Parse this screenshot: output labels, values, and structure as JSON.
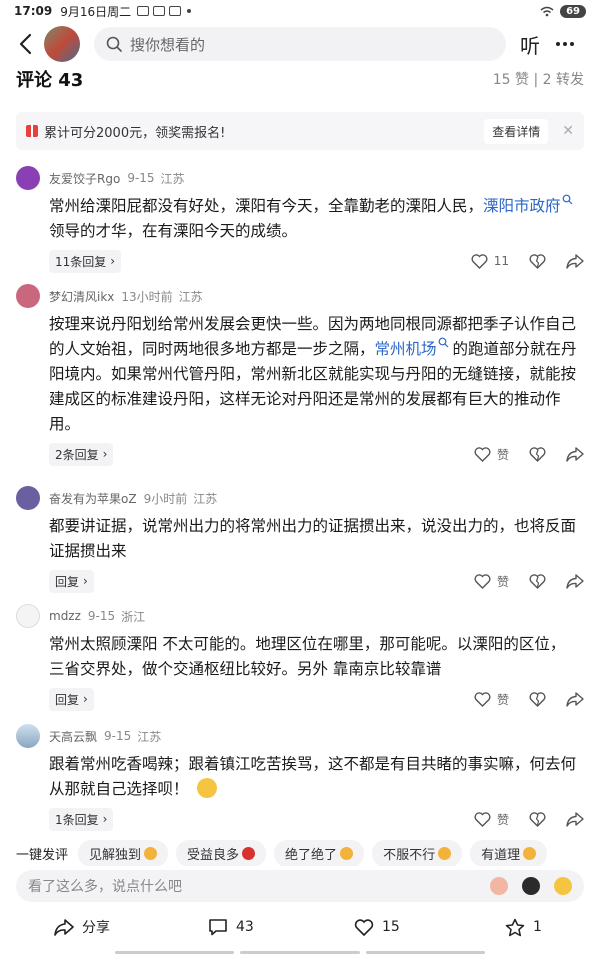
{
  "status": {
    "time": "17:09",
    "date": "9月16日周二",
    "battery": "69"
  },
  "topnav": {
    "search_placeholder": "搜你想看的",
    "listen": "听"
  },
  "header": {
    "title": "评论 43",
    "stats": "15 赞 | 2 转发"
  },
  "promo": {
    "text": "累计可分2000元，领奖需报名!",
    "button": "查看详情",
    "close": "✕"
  },
  "comments": [
    {
      "name": "友爱饺子Rgo",
      "time": "9-15",
      "location": "江苏",
      "text_before": "常州给溧阳屁都没有好处，溧阳有今天，全靠勤老的溧阳人民，",
      "link": "溧阳市政府",
      "text_after": "领导的才华，在有溧阳今天的成绩。",
      "replies": "11条回复",
      "likes": "11"
    },
    {
      "name": "梦幻清风ikx",
      "time": "13小时前",
      "location": "江苏",
      "text_before": "按理来说丹阳划给常州发展会更快一些。因为两地同根同源都把季子认作自己的人文始祖，同时两地很多地方都是一步之隔，",
      "link": "常州机场",
      "text_after": "的跑道部分就在丹阳境内。如果常州代管丹阳，常州新北区就能实现与丹阳的无缝链接，就能按建成区的标准建设丹阳，这样无论对丹阳还是常州的发展都有巨大的推动作用。",
      "replies": "2条回复",
      "likes": "赞"
    },
    {
      "name": "奋发有为苹果oZ",
      "time": "9小时前",
      "location": "江苏",
      "text_before": "都要讲证据，说常州出力的将常州出力的证据掼出来，说没出力的，也将反面证据掼出来",
      "link": "",
      "text_after": "",
      "replies": "回复",
      "likes": "赞"
    },
    {
      "name": "mdzz",
      "time": "9-15",
      "location": "浙江",
      "text_before": "常州太照顾溧阳 不太可能的。地理区位在哪里，那可能呢。以溧阳的区位，三省交界处，做个交通枢纽比较好。另外 靠南京比较靠谱",
      "link": "",
      "text_after": "",
      "replies": "回复",
      "likes": "赞"
    },
    {
      "name": "天高云飘",
      "time": "9-15",
      "location": "江苏",
      "text_before": "跟着常州吃香喝辣；跟着镇江吃苦挨骂，这不都是有目共睹的事实嘛，何去何从那就自己选择呗！",
      "link": "",
      "text_after": "",
      "replies": "1条回复",
      "likes": "赞"
    }
  ],
  "quick": {
    "label": "一键发评",
    "chips": [
      "见解独到",
      "受益良多",
      "绝了绝了",
      "不服不行",
      "有道理"
    ]
  },
  "input": {
    "placeholder": "看了这么多，说点什么吧"
  },
  "bottom": {
    "share": "分享",
    "comments": "43",
    "likes": "15",
    "favorites": "1"
  },
  "colors": {
    "link": "#2c67c9",
    "promo_icon": "#e8413c"
  }
}
